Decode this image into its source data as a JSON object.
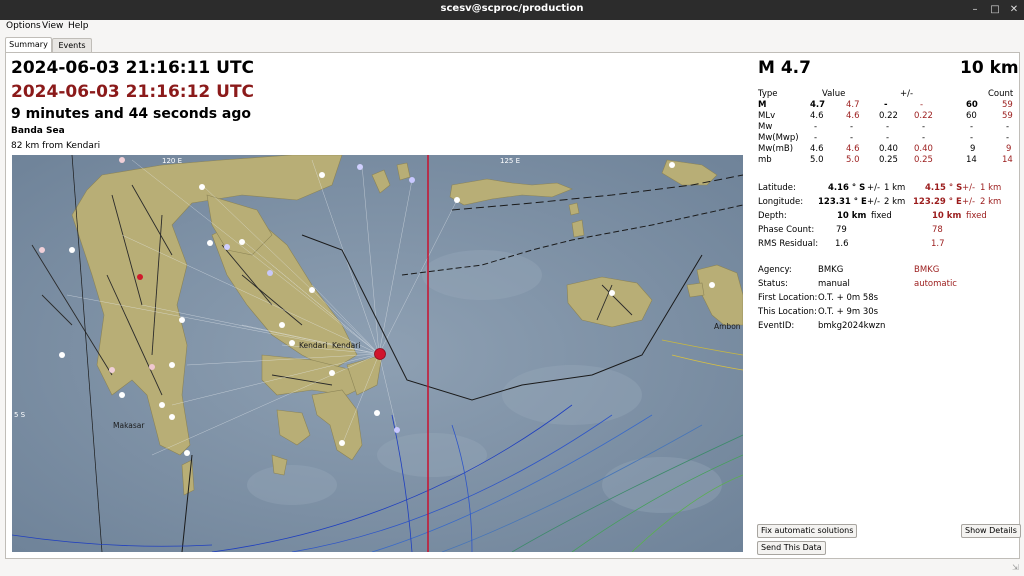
{
  "window": {
    "title": "scesv@scproc/production"
  },
  "menu": {
    "options": "Options",
    "view": "View",
    "help": "Help"
  },
  "tabs": {
    "summary": "Summary",
    "events": "Events"
  },
  "summary": {
    "time_current": "2024-06-03 21:16:11 UTC",
    "time_automatic": "2024-06-03 21:16:12 UTC",
    "ago": "9 minutes and 44 seconds ago",
    "region": "Banda Sea",
    "nearest": "82 km from Kendari"
  },
  "map": {
    "labels": {
      "lon_120": "120 E",
      "lon_125": "125 E",
      "lat_5": "5 S",
      "kendari": "Kendari",
      "kendari2": "Kendari",
      "makasar": "Makasar",
      "ambon": "Ambon"
    }
  },
  "magnitude": {
    "headline": "M 4.7",
    "depth_headline": "10 km",
    "table": {
      "headers": {
        "type": "Type",
        "value": "Value",
        "pm": "+/-",
        "count": "Count"
      },
      "rows": [
        {
          "type": "M",
          "v1": "4.7",
          "v2": "4.7",
          "e1": "-",
          "e2": "-",
          "c1": "60",
          "c2": "59"
        },
        {
          "type": "MLv",
          "v1": "4.6",
          "v2": "4.6",
          "e1": "0.22",
          "e2": "0.22",
          "c1": "60",
          "c2": "59"
        },
        {
          "type": "Mw",
          "v1": "-",
          "v2": "-",
          "e1": "-",
          "e2": "-",
          "c1": "-",
          "c2": "-"
        },
        {
          "type": "Mw(Mwp)",
          "v1": "-",
          "v2": "-",
          "e1": "-",
          "e2": "-",
          "c1": "-",
          "c2": "-"
        },
        {
          "type": "Mw(mB)",
          "v1": "4.6",
          "v2": "4.6",
          "e1": "0.40",
          "e2": "0.40",
          "c1": "9",
          "c2": "9"
        },
        {
          "type": "mb",
          "v1": "5.0",
          "v2": "5.0",
          "e1": "0.25",
          "e2": "0.25",
          "c1": "14",
          "c2": "14"
        }
      ]
    }
  },
  "origin": {
    "latitude": {
      "label": "Latitude:",
      "value": "4.16 ° S",
      "pm": "+/-",
      "err": "1 km",
      "value2": "4.15 ° S",
      "pm2": "+/-",
      "err2": "1 km"
    },
    "longitude": {
      "label": "Longitude:",
      "value": "123.31 ° E",
      "pm": "+/-",
      "err": "2 km",
      "value2": "123.29 ° E",
      "pm2": "+/-",
      "err2": "2 km"
    },
    "depth": {
      "label": "Depth:",
      "value": "10 km",
      "flag": "fixed",
      "value2": "10 km",
      "flag2": "fixed"
    },
    "phase_count": {
      "label": "Phase Count:",
      "value": "79",
      "value2": "78"
    },
    "rms": {
      "label": "RMS Residual:",
      "value": "1.6",
      "value2": "1.7"
    },
    "agency": {
      "label": "Agency:",
      "value": "BMKG",
      "value2": "BMKG"
    },
    "status": {
      "label": "Status:",
      "value": "manual",
      "value2": "automatic"
    },
    "first_location": {
      "label": "First Location:",
      "value": "O.T. + 0m 58s"
    },
    "this_location": {
      "label": "This Location:",
      "value": "O.T. + 9m 30s"
    },
    "event_id": {
      "label": "EventID:",
      "value": "bmkg2024kwzn"
    }
  },
  "buttons": {
    "fix_auto": "Fix automatic solutions",
    "show_details": "Show Details",
    "send_data": "Send This Data"
  },
  "colors": {
    "titlebar": "#2c2c2c",
    "automatic_red": "#9b1c1c",
    "epicenter": "#d0142c",
    "ocean": "#7f93a8",
    "land": "#b6ad78"
  }
}
